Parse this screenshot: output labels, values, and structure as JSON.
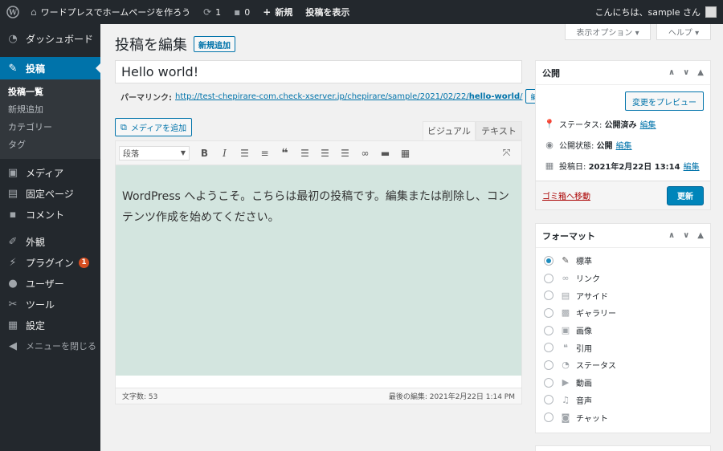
{
  "admin_bar": {
    "site_name": "ワードプレスでホームページを作ろう",
    "updates_count": "1",
    "comments_count": "0",
    "new_label": "新規",
    "view_post_label": "投稿を表示",
    "greeting": "こんにちは、sample さん",
    "icons": [
      "wordpress-icon",
      "home-icon",
      "updates-icon",
      "comment-icon",
      "plus-icon"
    ]
  },
  "sidebar": {
    "dashboard": "ダッシュボード",
    "posts": "投稿",
    "submenu": [
      "投稿一覧",
      "新規追加",
      "カテゴリー",
      "タグ"
    ],
    "media": "メディア",
    "pages": "固定ページ",
    "comments": "コメント",
    "appearance": "外観",
    "plugins": "プラグイン",
    "plugins_badge": "1",
    "users": "ユーザー",
    "tools": "ツール",
    "settings": "設定",
    "collapse": "メニューを閉じる"
  },
  "screen_meta": {
    "screen_options": "表示オプション ▾",
    "help": "ヘルプ ▾"
  },
  "editor": {
    "heading": "投稿を編集",
    "add_new": "新規追加",
    "title_value": "Hello world!",
    "permalink_label": "パーマリンク:",
    "permalink_base": "http://test-chepirare-com.check-xserver.jp/chepirare/sample/2021/02/22/",
    "permalink_slug": "hello-world",
    "permalink_trailing": "/",
    "permalink_edit": "編集",
    "add_media": "メディアを追加",
    "tab_visual": "ビジュアル",
    "tab_text": "テキスト",
    "format_select": "段落",
    "content": "WordPress へようこそ。こちらは最初の投稿です。編集または削除し、コンテンツ作成を始めてください。",
    "word_count": "文字数: 53",
    "last_edited": "最後の編集: 2021年2月22日 1:14 PM"
  },
  "publish_box": {
    "title": "公開",
    "preview_button": "変更をプレビュー",
    "status_label": "ステータス:",
    "status_value": "公開済み",
    "visibility_label": "公開状態:",
    "visibility_value": "公開",
    "date_label": "投稿日:",
    "date_value": "2021年2月22日 13:14",
    "edit": "編集",
    "trash": "ゴミ箱へ移動",
    "update": "更新"
  },
  "format_box": {
    "title": "フォーマット",
    "options": [
      "標準",
      "リンク",
      "アサイド",
      "ギャラリー",
      "画像",
      "引用",
      "ステータス",
      "動画",
      "音声",
      "チャット"
    ],
    "selected": "標準"
  },
  "colors": {
    "accent": "#0073aa",
    "sidebar_bg": "#23282d",
    "content_bg": "#d3e5df",
    "update_button": "#0085ba"
  }
}
